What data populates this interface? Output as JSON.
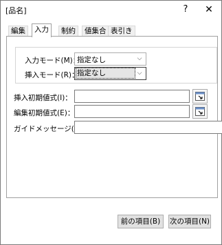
{
  "window": {
    "title": "[品名]",
    "help_glyph": "?",
    "close_glyph": "✕"
  },
  "tabs": [
    {
      "label": "編集",
      "active": false
    },
    {
      "label": "入力",
      "active": true
    },
    {
      "label": "制約",
      "active": false
    },
    {
      "label": "値集合",
      "active": false
    },
    {
      "label": "表引き",
      "active": false
    }
  ],
  "input_mode": {
    "label": "入力モード(M)：",
    "value": "指定なし"
  },
  "insert_mode": {
    "label": "挿入モード(R)：",
    "value": "指定なし"
  },
  "insert_initial": {
    "label": "挿入初期値式(I)：",
    "value": ""
  },
  "edit_initial": {
    "label": "編集初期値式(E)：",
    "value": ""
  },
  "guide_message": {
    "label": "ガイドメッセージ(G)：",
    "value": ""
  },
  "buttons": {
    "prev": "前の項目(B)",
    "next": "次の項目(N)"
  },
  "colors": {
    "border": "#a0a0a0",
    "button_face": "#e1e1e1"
  }
}
